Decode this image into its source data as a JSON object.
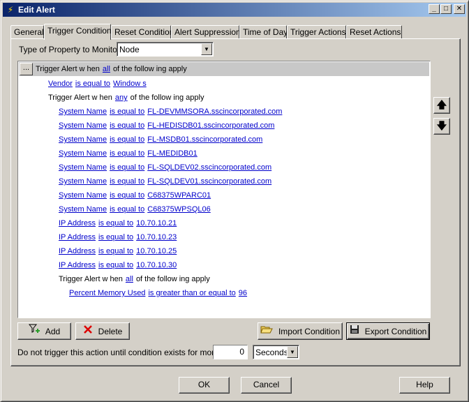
{
  "window": {
    "title": "Edit Alert",
    "app_icon": "lightning-icon",
    "minimize_glyph": "_",
    "maximize_glyph": "□",
    "close_glyph": "✕"
  },
  "tabs": [
    {
      "label": "General",
      "active": false
    },
    {
      "label": "Trigger Condition",
      "active": true
    },
    {
      "label": "Reset Condition",
      "active": false
    },
    {
      "label": "Alert Suppression",
      "active": false
    },
    {
      "label": "Time of Day",
      "active": false
    },
    {
      "label": "Trigger Actions",
      "active": false
    },
    {
      "label": "Reset Actions",
      "active": false
    }
  ],
  "property": {
    "label": "Type of Property to Monitor:",
    "value": "Node"
  },
  "conditions": {
    "ellipsis": "...",
    "root": {
      "prefix": "Trigger Alert w hen",
      "mode": "all",
      "suffix": "of the follow ing apply"
    },
    "vendor": {
      "field": "Vendor",
      "op": "is equal to",
      "value": "Window s"
    },
    "group_any": {
      "prefix": "Trigger Alert w hen",
      "mode": "any",
      "suffix": "of the follow ing apply"
    },
    "items": [
      {
        "field": "System Name",
        "op": "is equal to",
        "value": "FL-DEVMMSORA.sscincorporated.com"
      },
      {
        "field": "System Name",
        "op": "is equal to",
        "value": "FL-HEDISDB01.sscincorporated.com"
      },
      {
        "field": "System Name",
        "op": "is equal to",
        "value": "FL-MSDB01.sscincorporated.com"
      },
      {
        "field": "System Name",
        "op": "is equal to",
        "value": "FL-MEDIDB01"
      },
      {
        "field": "System Name",
        "op": "is equal to",
        "value": "FL-SQLDEV02.sscincorporated.com"
      },
      {
        "field": "System Name",
        "op": "is equal to",
        "value": "FL-SQLDEV01.sscincorporated.com"
      },
      {
        "field": "System Name",
        "op": "is equal to",
        "value": "C68375WPARC01"
      },
      {
        "field": "System Name",
        "op": "is equal to",
        "value": "C68375WPSQL06"
      },
      {
        "field": "IP Address",
        "op": "is equal to",
        "value": "10.70.10.21"
      },
      {
        "field": "IP Address",
        "op": "is equal to",
        "value": "10.70.10.23"
      },
      {
        "field": "IP Address",
        "op": "is equal to",
        "value": "10.70.10.25"
      },
      {
        "field": "IP Address",
        "op": "is equal to",
        "value": "10.70.10.30"
      }
    ],
    "group_all": {
      "prefix": "Trigger Alert w hen",
      "mode": "all",
      "suffix": "of the follow ing apply"
    },
    "memory": {
      "field": "Percent Memory Used",
      "op": "is greater than or equal to",
      "value": "96"
    }
  },
  "move_up_glyph": "🡅",
  "move_down_glyph": "🡇",
  "actions": {
    "add": "Add",
    "delete": "Delete",
    "import": "Import Condition",
    "export": "Export Condition"
  },
  "duration": {
    "label": "Do not trigger this action until condition exists for more than",
    "value": "0",
    "unit": "Seconds"
  },
  "footer": {
    "ok": "OK",
    "cancel": "Cancel",
    "help": "Help"
  }
}
